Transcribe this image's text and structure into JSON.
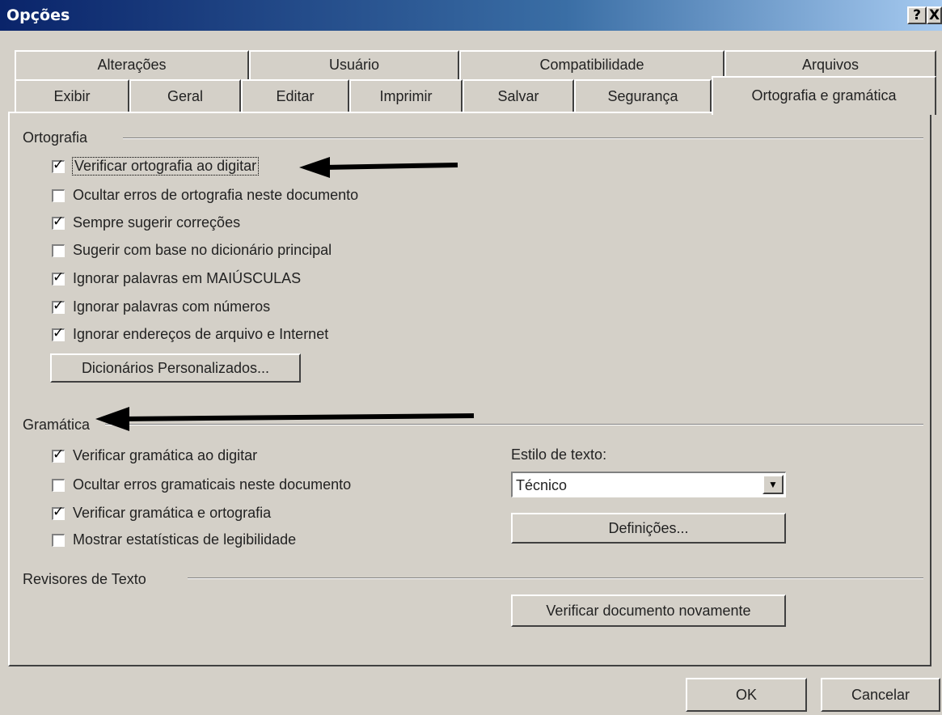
{
  "window": {
    "title": "Opções",
    "help_label": "?",
    "close_label": "X"
  },
  "tabs": {
    "row1": [
      "Alterações",
      "Usuário",
      "Compatibilidade",
      "Arquivos"
    ],
    "row2": [
      "Exibir",
      "Geral",
      "Editar",
      "Imprimir",
      "Salvar",
      "Segurança",
      "Ortografia e gramática"
    ],
    "active": "Ortografia e gramática"
  },
  "ortografia": {
    "label": "Ortografia",
    "options": [
      {
        "label": "Verificar ortografia ao digitar",
        "checked": true
      },
      {
        "label": "Ocultar erros de ortografia neste documento",
        "checked": false
      },
      {
        "label": "Sempre sugerir correções",
        "checked": true
      },
      {
        "label": "Sugerir com base no dicionário principal",
        "checked": false
      },
      {
        "label": "Ignorar palavras em MAIÚSCULAS",
        "checked": true
      },
      {
        "label": "Ignorar palavras com números",
        "checked": true
      },
      {
        "label": "Ignorar endereços de arquivo e Internet",
        "checked": true
      }
    ],
    "dictionaries_button": "Dicionários Personalizados..."
  },
  "gramatica": {
    "label": "Gramática",
    "options": [
      {
        "label": "Verificar gramática ao digitar",
        "checked": true
      },
      {
        "label": "Ocultar erros gramaticais neste documento",
        "checked": false
      },
      {
        "label": "Verificar gramática e ortografia",
        "checked": true
      },
      {
        "label": "Mostrar estatísticas de legibilidade",
        "checked": false
      }
    ],
    "style_label": "Estilo de texto:",
    "style_value": "Técnico",
    "settings_button": "Definições..."
  },
  "revisores": {
    "label": "Revisores de Texto",
    "recheck_button": "Verificar documento novamente"
  },
  "footer": {
    "ok": "OK",
    "cancel": "Cancelar"
  },
  "colors": {
    "dialog_bg": "#d4d0c8",
    "titlebar": "#0a246a",
    "arrow": "#000000"
  }
}
